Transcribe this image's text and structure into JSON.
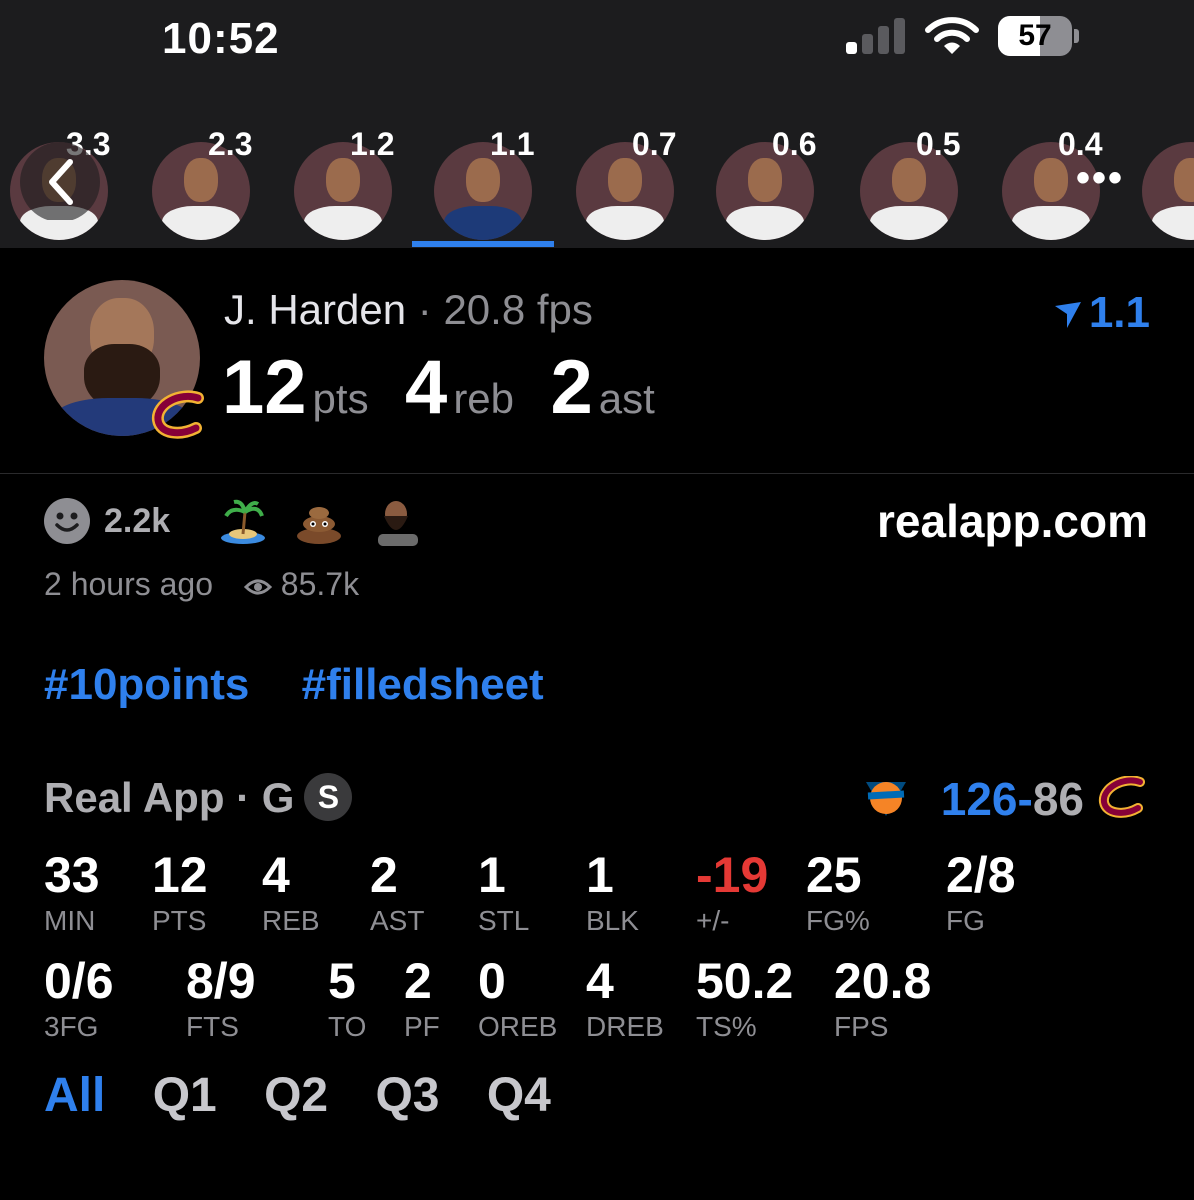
{
  "status_bar": {
    "time": "10:52",
    "battery": "57",
    "battery_level": 0.57
  },
  "player_strip": {
    "values": [
      "3.3",
      "2.3",
      "1.2",
      "1.1",
      "0.7",
      "0.6",
      "0.5",
      "0.4"
    ],
    "selected_index": 3,
    "more_label": "•••"
  },
  "player": {
    "name": "J. Harden",
    "separator": "·",
    "fps": "20.8 fps",
    "pts": "12",
    "pts_unit": "pts",
    "reb": "4",
    "reb_unit": "reb",
    "ast": "2",
    "ast_unit": "ast",
    "rating": "1.1"
  },
  "post": {
    "reaction_count": "2.2k",
    "reaction_icons": [
      "smiley-icon",
      "island-icon",
      "poop-icon",
      "harden-emoji-icon"
    ],
    "site": "realapp.com",
    "time_ago": "2 hours ago",
    "views": "85.7k",
    "tags": [
      "#10points",
      "#filledsheet"
    ]
  },
  "game": {
    "label": "Real App · G",
    "badge": "S",
    "score_winner": "126",
    "score_dash": "-",
    "score_loser": "86"
  },
  "stats_row1": [
    {
      "v": "33",
      "k": "MIN"
    },
    {
      "v": "12",
      "k": "PTS"
    },
    {
      "v": "4",
      "k": "REB"
    },
    {
      "v": "2",
      "k": "AST"
    },
    {
      "v": "1",
      "k": "STL"
    },
    {
      "v": "1",
      "k": "BLK"
    },
    {
      "v": "-19",
      "k": "+/-"
    },
    {
      "v": "25",
      "k": "FG%"
    },
    {
      "v": "2/8",
      "k": "FG"
    }
  ],
  "stats_row2": [
    {
      "v": "0/6",
      "k": "3FG"
    },
    {
      "v": "8/9",
      "k": "FTS"
    },
    {
      "v": "5",
      "k": "TO"
    },
    {
      "v": "2",
      "k": "PF"
    },
    {
      "v": "0",
      "k": "OREB"
    },
    {
      "v": "4",
      "k": "DREB"
    },
    {
      "v": "50.2",
      "k": "TS%"
    },
    {
      "v": "20.8",
      "k": "FPS"
    }
  ],
  "quarters": [
    "All",
    "Q1",
    "Q2",
    "Q3",
    "Q4"
  ],
  "colors": {
    "accent": "#2f80ed",
    "negative": "#e53935",
    "muted": "#8e8e93"
  }
}
